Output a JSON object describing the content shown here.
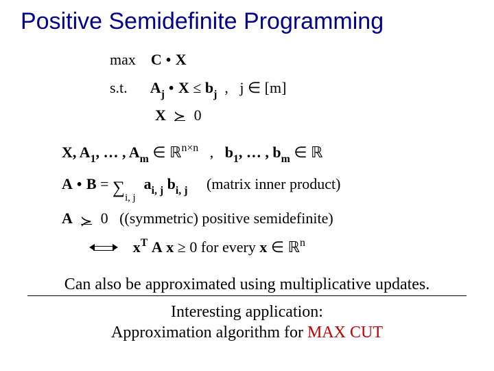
{
  "title": "Positive Semidefinite Programming",
  "math": {
    "l1a": "max",
    "l1b_C": "C",
    "l1b_X": "X",
    "l2a": "s.t.",
    "l2_Aj": "A",
    "l2_j1": "j",
    "l2_X": "X",
    "l2_le": "≤",
    "l2_b": "b",
    "l2_j2": "j",
    "l2_comma": ",",
    "l2_jm": "j ∈ [m]",
    "l3_X": "X",
    "l3_zero": "0",
    "domain_XA": "X, A",
    "domain_one": "1",
    "domain_dots": ", … , A",
    "domain_m": "m",
    "domain_in": " ∈ ",
    "domain_nn": "n×n",
    "domain_comma": ",",
    "domain_bs": "b",
    "domain_b1": "1",
    "domain_bdots": ", … , b",
    "domain_bm": "m",
    "ip_A": "A",
    "ip_B": "B",
    "ip_eq": " = ",
    "ip_sumlim": "i, j",
    "ip_a": "a",
    "ip_isub": "i, j",
    "ip_b": "b",
    "ip_paren": "(matrix inner product)",
    "psd_A": "A",
    "psd_zero": "0",
    "psd_paren": "((symmetric) positive semidefinite)",
    "quad_xT": "x",
    "quad_T": "T",
    "quad_A": "A",
    "quad_x2": "x",
    "quad_ge": " ≥ 0",
    "quad_for": " for every ",
    "quad_xin": "x",
    "quad_n": "n"
  },
  "footer": {
    "line1": "Can also be approximated using multiplicative updates.",
    "line2a": "Interesting application:",
    "line2b": "Approximation algorithm for ",
    "line2c": "MAX CUT"
  }
}
